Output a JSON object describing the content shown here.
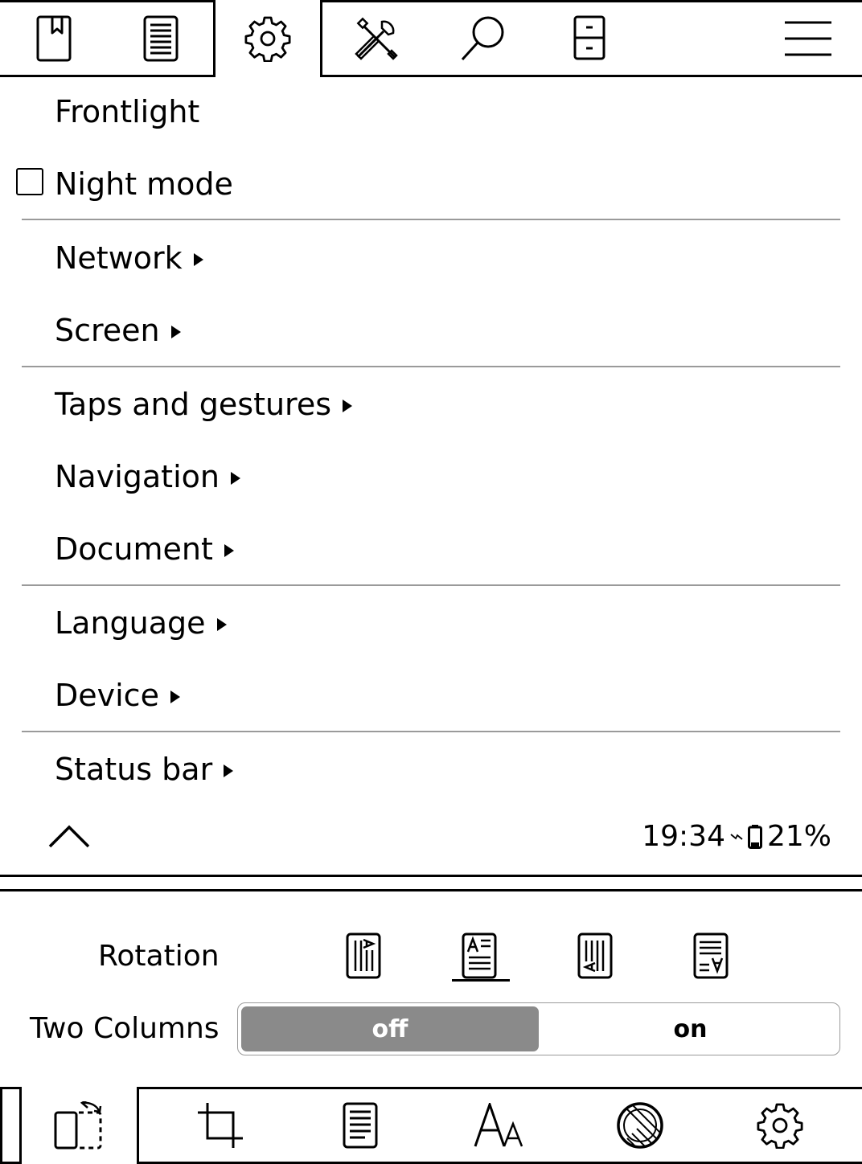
{
  "top_tabs": [
    {
      "icon": "bookmark-icon"
    },
    {
      "icon": "document-icon"
    },
    {
      "icon": "gear-icon",
      "active": true
    },
    {
      "icon": "tools-icon"
    },
    {
      "icon": "search-icon"
    },
    {
      "icon": "filemanager-icon"
    },
    {
      "icon": "hamburger-menu-icon"
    }
  ],
  "menu": {
    "items": [
      {
        "id": "frontlight",
        "label": "Frontlight",
        "submenu": false
      },
      {
        "id": "night-mode",
        "label": "Night mode",
        "checkbox": true,
        "checked": false
      },
      {
        "id": "network",
        "label": "Network",
        "submenu": true
      },
      {
        "id": "screen",
        "label": "Screen",
        "submenu": true
      },
      {
        "id": "taps-and-gestures",
        "label": "Taps and gestures",
        "submenu": true
      },
      {
        "id": "navigation",
        "label": "Navigation",
        "submenu": true
      },
      {
        "id": "document",
        "label": "Document",
        "submenu": true
      },
      {
        "id": "language",
        "label": "Language",
        "submenu": true
      },
      {
        "id": "device",
        "label": "Device",
        "submenu": true
      },
      {
        "id": "status-bar",
        "label": "Status bar",
        "submenu": true
      }
    ]
  },
  "status": {
    "time": "19:34",
    "battery_percent": "21%",
    "charging": true
  },
  "config": {
    "rotation_label": "Rotation",
    "rotation_selected_index": 1,
    "two_columns_label": "Two Columns",
    "two_columns_options": [
      "off",
      "on"
    ],
    "two_columns_value": "off"
  },
  "bottom_tabs": [
    {
      "icon": "rotate-page-icon",
      "active": true
    },
    {
      "icon": "crop-icon"
    },
    {
      "icon": "page-icon"
    },
    {
      "icon": "font-size-icon"
    },
    {
      "icon": "contrast-icon"
    },
    {
      "icon": "gear-icon"
    }
  ]
}
